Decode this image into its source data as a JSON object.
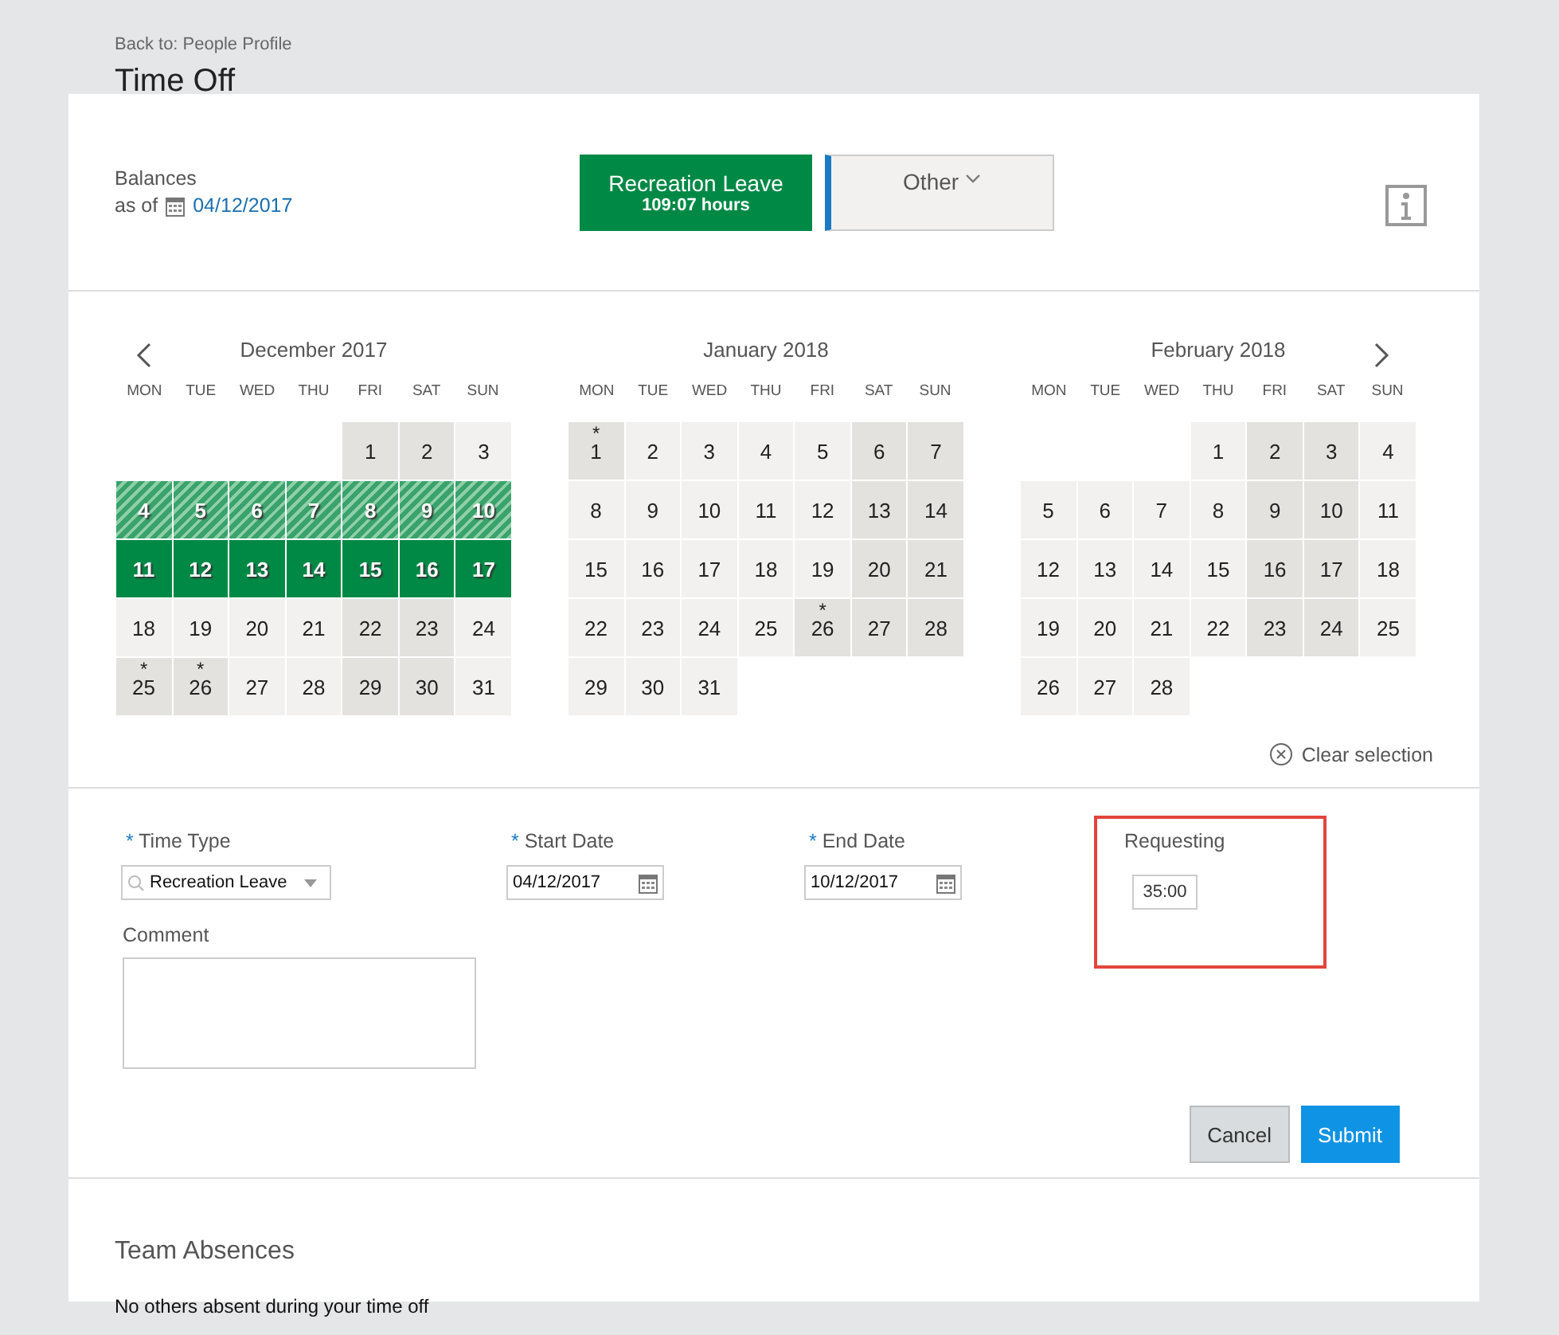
{
  "breadcrumb": "Back to: People Profile",
  "title": "Time Off",
  "balances": {
    "label": "Balances",
    "as_of_label": "as of",
    "date": "04/12/2017"
  },
  "balance_tabs": [
    {
      "label": "Recreation Leave",
      "hours": "109:07 hours",
      "selected": true,
      "dropdown": false
    },
    {
      "label": "Other",
      "selected": false,
      "dropdown": true
    }
  ],
  "calendar": {
    "months": [
      {
        "title": "December 2017",
        "weekdays": [
          "MON",
          "TUE",
          "WED",
          "THU",
          "FRI",
          "SAT",
          "SUN"
        ],
        "weeks": [
          [
            {
              "kind": "blank"
            },
            {
              "kind": "blank"
            },
            {
              "kind": "blank"
            },
            {
              "kind": "blank"
            },
            {
              "d": "1",
              "kind": "off"
            },
            {
              "d": "2",
              "kind": "off"
            },
            {
              "d": "3",
              "kind": "work"
            }
          ],
          [
            {
              "d": "4",
              "kind": "hatched"
            },
            {
              "d": "5",
              "kind": "hatched"
            },
            {
              "d": "6",
              "kind": "hatched"
            },
            {
              "d": "7",
              "kind": "hatched"
            },
            {
              "d": "8",
              "kind": "hatched"
            },
            {
              "d": "9",
              "kind": "hatched"
            },
            {
              "d": "10",
              "kind": "hatched"
            }
          ],
          [
            {
              "d": "11",
              "kind": "booked"
            },
            {
              "d": "12",
              "kind": "booked"
            },
            {
              "d": "13",
              "kind": "booked"
            },
            {
              "d": "14",
              "kind": "booked"
            },
            {
              "d": "15",
              "kind": "booked"
            },
            {
              "d": "16",
              "kind": "booked"
            },
            {
              "d": "17",
              "kind": "booked"
            }
          ],
          [
            {
              "d": "18",
              "kind": "work"
            },
            {
              "d": "19",
              "kind": "work"
            },
            {
              "d": "20",
              "kind": "work"
            },
            {
              "d": "21",
              "kind": "work"
            },
            {
              "d": "22",
              "kind": "off"
            },
            {
              "d": "23",
              "kind": "off"
            },
            {
              "d": "24",
              "kind": "work"
            }
          ],
          [
            {
              "d": "25",
              "kind": "off",
              "mark": "*"
            },
            {
              "d": "26",
              "kind": "off",
              "mark": "*"
            },
            {
              "d": "27",
              "kind": "work"
            },
            {
              "d": "28",
              "kind": "work"
            },
            {
              "d": "29",
              "kind": "off"
            },
            {
              "d": "30",
              "kind": "off"
            },
            {
              "d": "31",
              "kind": "work"
            }
          ]
        ]
      },
      {
        "title": "January 2018",
        "weekdays": [
          "MON",
          "TUE",
          "WED",
          "THU",
          "FRI",
          "SAT",
          "SUN"
        ],
        "weeks": [
          [
            {
              "d": "1",
              "kind": "off",
              "mark": "*"
            },
            {
              "d": "2",
              "kind": "work"
            },
            {
              "d": "3",
              "kind": "work"
            },
            {
              "d": "4",
              "kind": "work"
            },
            {
              "d": "5",
              "kind": "work"
            },
            {
              "d": "6",
              "kind": "off"
            },
            {
              "d": "7",
              "kind": "off"
            }
          ],
          [
            {
              "d": "8",
              "kind": "work"
            },
            {
              "d": "9",
              "kind": "work"
            },
            {
              "d": "10",
              "kind": "work"
            },
            {
              "d": "11",
              "kind": "work"
            },
            {
              "d": "12",
              "kind": "work"
            },
            {
              "d": "13",
              "kind": "off"
            },
            {
              "d": "14",
              "kind": "off"
            }
          ],
          [
            {
              "d": "15",
              "kind": "work"
            },
            {
              "d": "16",
              "kind": "work"
            },
            {
              "d": "17",
              "kind": "work"
            },
            {
              "d": "18",
              "kind": "work"
            },
            {
              "d": "19",
              "kind": "work"
            },
            {
              "d": "20",
              "kind": "off"
            },
            {
              "d": "21",
              "kind": "off"
            }
          ],
          [
            {
              "d": "22",
              "kind": "work"
            },
            {
              "d": "23",
              "kind": "work"
            },
            {
              "d": "24",
              "kind": "work"
            },
            {
              "d": "25",
              "kind": "work"
            },
            {
              "d": "26",
              "kind": "off",
              "mark": "*"
            },
            {
              "d": "27",
              "kind": "off"
            },
            {
              "d": "28",
              "kind": "off"
            }
          ],
          [
            {
              "d": "29",
              "kind": "work"
            },
            {
              "d": "30",
              "kind": "work"
            },
            {
              "d": "31",
              "kind": "work"
            },
            {
              "kind": "blank"
            },
            {
              "kind": "blank"
            },
            {
              "kind": "blank"
            },
            {
              "kind": "blank"
            }
          ]
        ]
      },
      {
        "title": "February 2018",
        "weekdays": [
          "MON",
          "TUE",
          "WED",
          "THU",
          "FRI",
          "SAT",
          "SUN"
        ],
        "weeks": [
          [
            {
              "kind": "blank"
            },
            {
              "kind": "blank"
            },
            {
              "kind": "blank"
            },
            {
              "d": "1",
              "kind": "work"
            },
            {
              "d": "2",
              "kind": "off"
            },
            {
              "d": "3",
              "kind": "off"
            },
            {
              "d": "4",
              "kind": "work"
            }
          ],
          [
            {
              "d": "5",
              "kind": "work"
            },
            {
              "d": "6",
              "kind": "work"
            },
            {
              "d": "7",
              "kind": "work"
            },
            {
              "d": "8",
              "kind": "work"
            },
            {
              "d": "9",
              "kind": "off"
            },
            {
              "d": "10",
              "kind": "off"
            },
            {
              "d": "11",
              "kind": "work"
            }
          ],
          [
            {
              "d": "12",
              "kind": "work"
            },
            {
              "d": "13",
              "kind": "work"
            },
            {
              "d": "14",
              "kind": "work"
            },
            {
              "d": "15",
              "kind": "work"
            },
            {
              "d": "16",
              "kind": "off"
            },
            {
              "d": "17",
              "kind": "off"
            },
            {
              "d": "18",
              "kind": "work"
            }
          ],
          [
            {
              "d": "19",
              "kind": "work"
            },
            {
              "d": "20",
              "kind": "work"
            },
            {
              "d": "21",
              "kind": "work"
            },
            {
              "d": "22",
              "kind": "work"
            },
            {
              "d": "23",
              "kind": "off"
            },
            {
              "d": "24",
              "kind": "off"
            },
            {
              "d": "25",
              "kind": "work"
            }
          ],
          [
            {
              "d": "26",
              "kind": "work"
            },
            {
              "d": "27",
              "kind": "work"
            },
            {
              "d": "28",
              "kind": "work"
            },
            {
              "kind": "blank"
            },
            {
              "kind": "blank"
            },
            {
              "kind": "blank"
            },
            {
              "kind": "blank"
            }
          ]
        ]
      }
    ],
    "clear_selection": "Clear selection"
  },
  "form": {
    "fields": [
      {
        "kind": "select",
        "required_mark": "*",
        "label": "Time Type",
        "value": "Recreation Leave"
      },
      {
        "kind": "date",
        "required_mark": "*",
        "label": "Start Date",
        "value": "04/12/2017"
      },
      {
        "kind": "date",
        "required_mark": "*",
        "label": "End Date",
        "value": "10/12/2017"
      }
    ],
    "requesting": {
      "label": "Requesting",
      "value": "35:00",
      "highlighted": true
    },
    "comment": {
      "label": "Comment"
    },
    "buttons": [
      {
        "label": "Cancel",
        "kind": "secondary"
      },
      {
        "label": "Submit",
        "kind": "primary"
      }
    ]
  },
  "team_absences": {
    "title": "Team Absences",
    "message": "No others absent during your time off"
  }
}
